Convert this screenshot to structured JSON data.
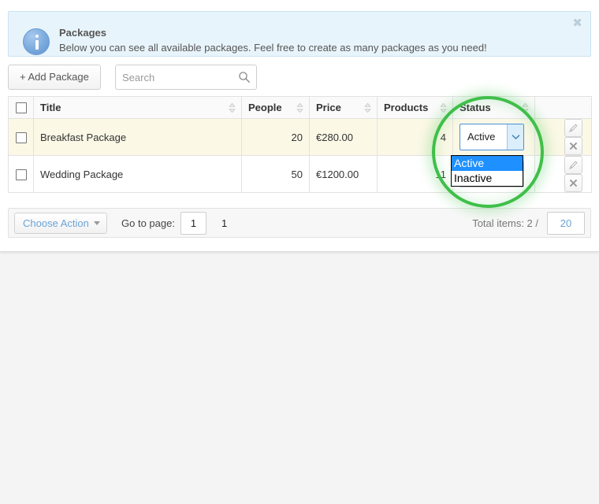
{
  "alert": {
    "icon": "info-icon",
    "title": "Packages",
    "message": "Below you can see all available packages. Feel free to create as many packages as you need!",
    "close_label": "✖",
    "bg_color": "#e8f4fb",
    "border_color": "#cbe3f0"
  },
  "toolbar": {
    "add_package_label": "+ Add Package",
    "search_placeholder": "Search",
    "search_value": "",
    "search_icon": "search-icon"
  },
  "table": {
    "columns": [
      {
        "key": "check",
        "label": "",
        "sortable": false
      },
      {
        "key": "title",
        "label": "Title",
        "sortable": true
      },
      {
        "key": "people",
        "label": "People",
        "sortable": true
      },
      {
        "key": "price",
        "label": "Price",
        "sortable": true
      },
      {
        "key": "products",
        "label": "Products",
        "sortable": true
      },
      {
        "key": "status",
        "label": "Status",
        "sortable": true
      },
      {
        "key": "actions",
        "label": "",
        "sortable": false
      }
    ],
    "rows": [
      {
        "title": "Breakfast Package",
        "people": "20",
        "price": "€280.00",
        "products": "4",
        "status": "Active",
        "checked": false,
        "highlighted": true
      },
      {
        "title": "Wedding Package",
        "people": "50",
        "price": "€1200.00",
        "products": "11",
        "status": "Active",
        "checked": false,
        "highlighted": false
      }
    ],
    "row_highlight_color": "#fbf8e6",
    "header_bg_color": "#fafafa"
  },
  "status_dropdown": {
    "open": true,
    "selected": "Active",
    "options": [
      {
        "label": "Active",
        "selected": true
      },
      {
        "label": "Inactive",
        "selected": false
      }
    ],
    "selected_bg_color": "#1e90ff",
    "focus_border_color": "#4a90d9"
  },
  "row_actions": {
    "edit_icon": "pencil-icon",
    "delete_icon": "close-icon"
  },
  "footer": {
    "choose_action_label": "Choose Action",
    "goto_page_label": "Go to page:",
    "page_value": "1",
    "page_count": "1",
    "total_items_label": "Total items: 2 /",
    "per_page_value": "20"
  },
  "highlight": {
    "shape": "circle",
    "color": "#3fbf49"
  }
}
